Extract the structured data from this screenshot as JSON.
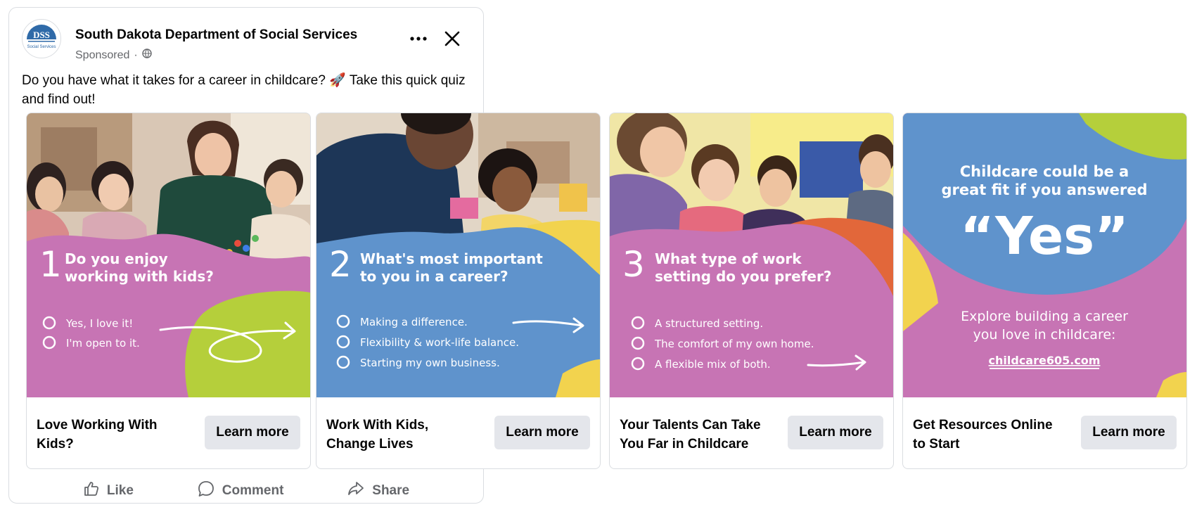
{
  "post": {
    "page_name": "South Dakota Department of Social Services",
    "sponsored": "Sponsored",
    "separator": "·",
    "avatar_logo_text": "DSS",
    "avatar_logo_sub": "Social Services",
    "caption": "Do you have what it takes for a career in childcare? 🚀 Take this quick quiz and find out!",
    "more_icon": "more-options-icon",
    "close_icon": "close-icon"
  },
  "cards": [
    {
      "number": "1",
      "question_line1": "Do you enjoy",
      "question_line2": "working with kids?",
      "options": [
        "Yes, I love it!",
        "I'm open to it."
      ],
      "headline": "Love Working With Kids?",
      "cta": "Learn more"
    },
    {
      "number": "2",
      "question_line1": "What's most important",
      "question_line2": "to you in a career?",
      "options": [
        "Making a difference.",
        "Flexibility & work-life balance.",
        "Starting my own business."
      ],
      "headline": "Work With Kids, Change Lives",
      "cta": "Learn more"
    },
    {
      "number": "3",
      "question_line1": "What type of work",
      "question_line2": "setting do you prefer?",
      "options": [
        "A structured setting.",
        "The comfort of my own home.",
        "A flexible mix of both."
      ],
      "headline": "Your Talents Can Take You Far in Childcare",
      "cta": "Learn more"
    },
    {
      "line1": "Childcare could be a",
      "line2": "great fit if you answered",
      "yes": "“Yes”",
      "explore1": "Explore building a career",
      "explore2": "you love in childcare:",
      "url": "childcare605.com",
      "headline": "Get Resources Online to Start",
      "cta": "Learn more"
    }
  ],
  "actions": {
    "like": "Like",
    "comment": "Comment",
    "share": "Share"
  },
  "colors": {
    "pink": "#c774b4",
    "blue": "#5f93cc",
    "lime": "#b5cf3b",
    "yellow": "#f2d34e",
    "orange": "#e2673a",
    "button_bg": "#e4e6eb",
    "meta_gray": "#65676b"
  }
}
